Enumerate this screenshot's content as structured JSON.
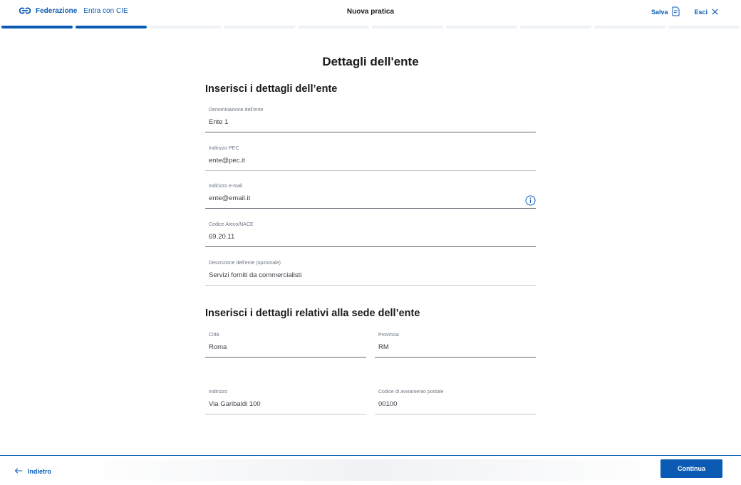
{
  "header": {
    "brand_bold": "Federazione",
    "brand_light": "Entra con CIE",
    "title": "Nuova pratica",
    "save_label": "Salva",
    "exit_label": "Esci"
  },
  "progress": {
    "total_steps": 10,
    "completed_steps": 2
  },
  "main": {
    "heading": "Dettagli dell'ente",
    "section1_title": "Inserisci i dettagli dell’ente",
    "fields": {
      "denominazione": {
        "label": "Denominazione dell'ente",
        "value": "Ente 1"
      },
      "pec": {
        "label": "Indirizzo PEC",
        "value": "ente@pec.it"
      },
      "email": {
        "label": "Indirizzo e-mail",
        "value": "ente@email.it"
      },
      "ateco": {
        "label": "Codice Ateco/NACE",
        "value": "69.20.11"
      },
      "descrizione": {
        "label": "Descrizione dell'ente (opzionale)",
        "value": "Servizi forniti da commercialisti"
      }
    },
    "section2_title": "Inserisci i dettagli relativi alla sede dell’ente",
    "sede": {
      "citta": {
        "label": "Città",
        "value": "Roma"
      },
      "provincia": {
        "label": "Provincia",
        "value": "RM"
      },
      "indirizzo": {
        "label": "Indirizzo",
        "value": "Via Garibaldi 100"
      },
      "cap": {
        "label": "Codice di avviamento postale",
        "value": "00100"
      }
    }
  },
  "footer": {
    "back_label": "Indietro",
    "continue_label": "Continua"
  },
  "colors": {
    "accent": "#0b5bb5",
    "progress_inactive": "#eef1f5",
    "text": "#1a1a1a"
  },
  "icons": [
    "federation-logo-icon",
    "document-icon",
    "close-icon",
    "info-icon",
    "arrow-left-icon"
  ]
}
